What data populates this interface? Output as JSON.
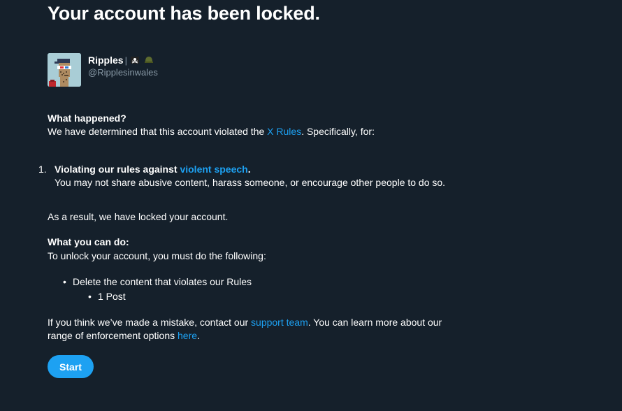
{
  "title": "Your account has been locked.",
  "account": {
    "display_name": "Ripples",
    "separator": "|",
    "badge_icons": [
      "pirate-flag-icon",
      "army-helmet-icon"
    ],
    "handle": "@Ripplesinwales"
  },
  "what_happened": {
    "heading": "What happened?",
    "text_before": "We have determined that this account violated the ",
    "rules_link": "X Rules",
    "text_after": ". Specifically, for:"
  },
  "violations": [
    {
      "number": "1.",
      "title_before": "Violating our rules against ",
      "title_link": "violent speech",
      "title_after": ".",
      "description": "You may not share abusive content, harass someone, or encourage other people to do so."
    }
  ],
  "result_text": "As a result, we have locked your account.",
  "what_you_can_do": {
    "heading": "What you can do:",
    "text": "To unlock your account, you must do the following:",
    "steps": [
      "Delete the content that violates our Rules"
    ],
    "sub_steps": [
      "1 Post"
    ]
  },
  "contact": {
    "line1_before": "If you think we’ve made a mistake, contact our ",
    "support_link": "support team",
    "line1_after": ". You can learn more about our",
    "line2_before": "range of enforcement options ",
    "here_link": "here",
    "line2_after": "."
  },
  "start_button": "Start",
  "colors": {
    "background": "#15202b",
    "accent": "#1da1f2",
    "secondary_text": "#8899a6"
  }
}
